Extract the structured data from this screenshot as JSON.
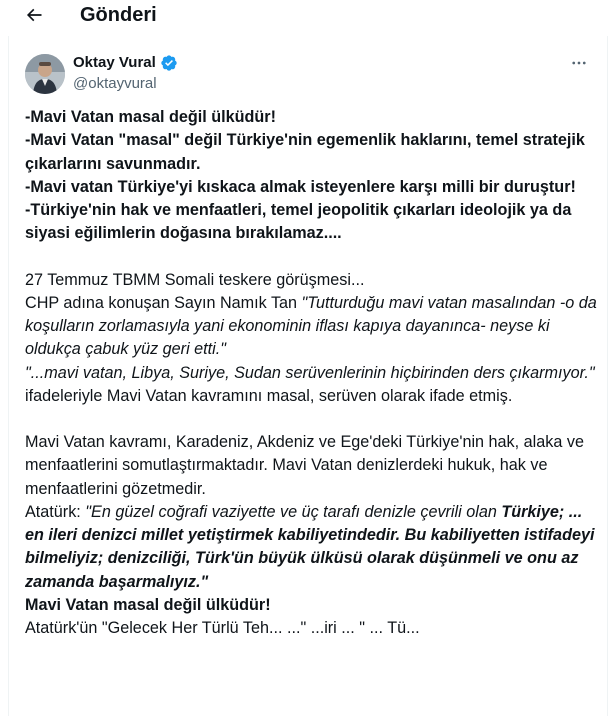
{
  "header": {
    "title": "Gönderi"
  },
  "author": {
    "name": "Oktay Vural",
    "handle": "@oktayvural"
  },
  "colors": {
    "verified": "#1d9bf0",
    "muted": "#536471",
    "text": "#0f1419"
  },
  "icons": {
    "back": "arrow-left-icon",
    "verified": "verified-badge-icon",
    "more": "more-horizontal-icon"
  },
  "post": {
    "bold_lines": [
      "-Mavi Vatan masal değil ülküdür!",
      "-Mavi Vatan \"masal\" değil Türkiye'nin egemenlik haklarını, temel stratejik çıkarlarını savunmadır.",
      "-Mavi vatan Türkiye'yi kıskaca almak isteyenlere karşı milli bir duruştur!",
      "-Türkiye'nin hak ve menfaatleri, temel jeopolitik çıkarları ideolojik ya da siyasi eğilimlerin doğasına bırakılamaz...."
    ],
    "p2_line1": "27 Temmuz TBMM Somali teskere görüşmesi...",
    "p2_intro": "CHP adına konuşan Sayın Namık Tan ",
    "p2_quote1": "\"Tutturduğu mavi vatan masalından -o da koşulların zorlamasıyla yani ekonominin iflası kapıya dayanınca- neyse ki oldukça çabuk yüz geri etti.\"",
    "p2_quote2": "\"...mavi vatan, Libya, Suriye, Sudan serüvenlerinin hiçbirinden ders çıkarmıyor.\"",
    "p2_tail": " ifadeleriyle Mavi Vatan kavramını masal, serüven olarak ifade etmiş.",
    "p3_text": "Mavi Vatan kavramı, Karadeniz, Akdeniz ve Ege'deki Türkiye'nin  hak, alaka ve menfaatlerini somutlaştırmaktadır. Mavi Vatan denizlerdeki hukuk, hak ve menfaatlerini gözetmedir.",
    "p3_ataturk": "Atatürk: ",
    "p3_quote_italic": "\"En güzel coğrafi vaziyette ve üç tarafı denizle çevrili olan ",
    "p3_quote_bold": "Türkiye; ... en ileri denizci millet yetiştirmek kabiliyetindedir. Bu kabiliyetten istifadeyi bilmeliyiz; denizciliği, Türk'ün büyük ülküsü olarak düşünmeli ve onu az zamanda başarmalıyız.\"",
    "p3_final": "Mavi Vatan masal değil ülküdür!",
    "p3_cut": "Atatürk'ün \"Gelecek Her Türlü Teh... ...\" ...iri ... \" ... Tü..."
  }
}
